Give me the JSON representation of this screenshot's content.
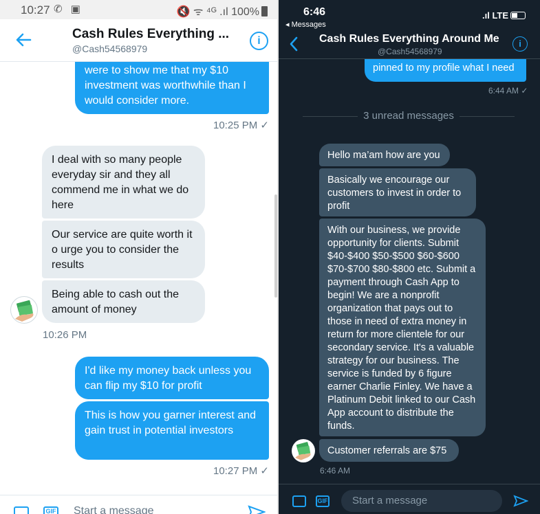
{
  "left": {
    "status": {
      "time": "10:27",
      "icons": "✆ ▣",
      "right": "🔇 ᯤ ⁴ᴳ .ıl",
      "battery": "100%"
    },
    "header": {
      "title": "Cash Rules Everything ...",
      "handle": "@Cash54568979",
      "info": "i"
    },
    "messages": [
      {
        "dir": "out",
        "text": "were to show me that my $10 investment was worthwhile than I would consider more."
      },
      {
        "dir": "time",
        "text": "10:25 PM ✓"
      },
      {
        "dir": "in",
        "text": "I deal with so many people everyday sir and they all commend me in what we do here"
      },
      {
        "dir": "in",
        "text": "Our service are quite worth it o urge you to consider the results"
      },
      {
        "dir": "in",
        "text": "Being able to cash out the amount of money"
      },
      {
        "dir": "time",
        "text": "10:26 PM"
      },
      {
        "dir": "out",
        "text": "I'd like my money back unless you can flip my $10 for profit"
      },
      {
        "dir": "out",
        "text": "This is how you garner interest and gain trust in potential investors"
      },
      {
        "dir": "time",
        "text": "10:27 PM ✓"
      }
    ],
    "compose": {
      "gif": "GIF",
      "placeholder": "Start a message"
    }
  },
  "right": {
    "status": {
      "time": "6:46",
      "back_app": "◂ Messages",
      "signal": ".ıl LTE"
    },
    "header": {
      "title": "Cash Rules Everything Around Me",
      "handle": "@Cash54568979",
      "info": "i"
    },
    "messages": [
      {
        "dir": "out",
        "text": "pinned to my profile what I need"
      },
      {
        "dir": "time",
        "text": "6:44 AM ✓"
      },
      {
        "dir": "divider",
        "text": "3 unread messages"
      },
      {
        "dir": "in",
        "text": "Hello ma’am how are you"
      },
      {
        "dir": "in",
        "text": "Basically we encourage our customers to invest in order to profit"
      },
      {
        "dir": "in",
        "text": "With our business, we provide opportunity for clients. Submit $40-$400 $50-$500 $60-$600 $70-$700 $80-$800 etc. Submit a payment through Cash App to begin! We are a nonprofit organization that pays out to those in need of extra money in return for more clientele for our secondary service. It's a valuable strategy for our business. The service is funded by 6 figure earner Charlie Finley. We have a Platinum Debit linked to our Cash App account to distribute the funds."
      },
      {
        "dir": "in",
        "text": "Customer referrals are $75"
      },
      {
        "dir": "time",
        "text": "6:46 AM"
      }
    ],
    "compose": {
      "gif": "GIF",
      "placeholder": "Start a message"
    }
  },
  "colors": {
    "accent": "#1da1f2",
    "dark_bg": "#15202b",
    "dark_bubble": "#3d5466",
    "light_bubble": "#e6ecf0"
  }
}
